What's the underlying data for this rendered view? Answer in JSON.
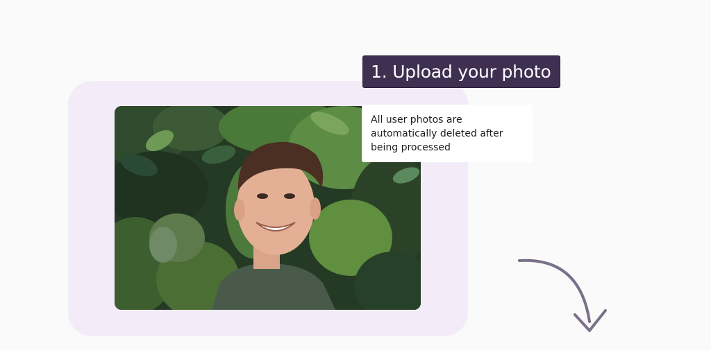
{
  "step": {
    "title": "1. Upload your photo"
  },
  "note": {
    "lines": [
      "All user photos are",
      "automatically deleted after",
      "being processed"
    ]
  },
  "colors": {
    "page_background": "#fafafa",
    "panel_background": "#f3ecf8",
    "title_background": "#3f3052",
    "arrow": "#7a7088"
  },
  "photo": {
    "subject": "smiling young man with curly hair in front of a wall of green plants"
  },
  "icons": {
    "arrow": "curved-down-arrow-icon"
  }
}
